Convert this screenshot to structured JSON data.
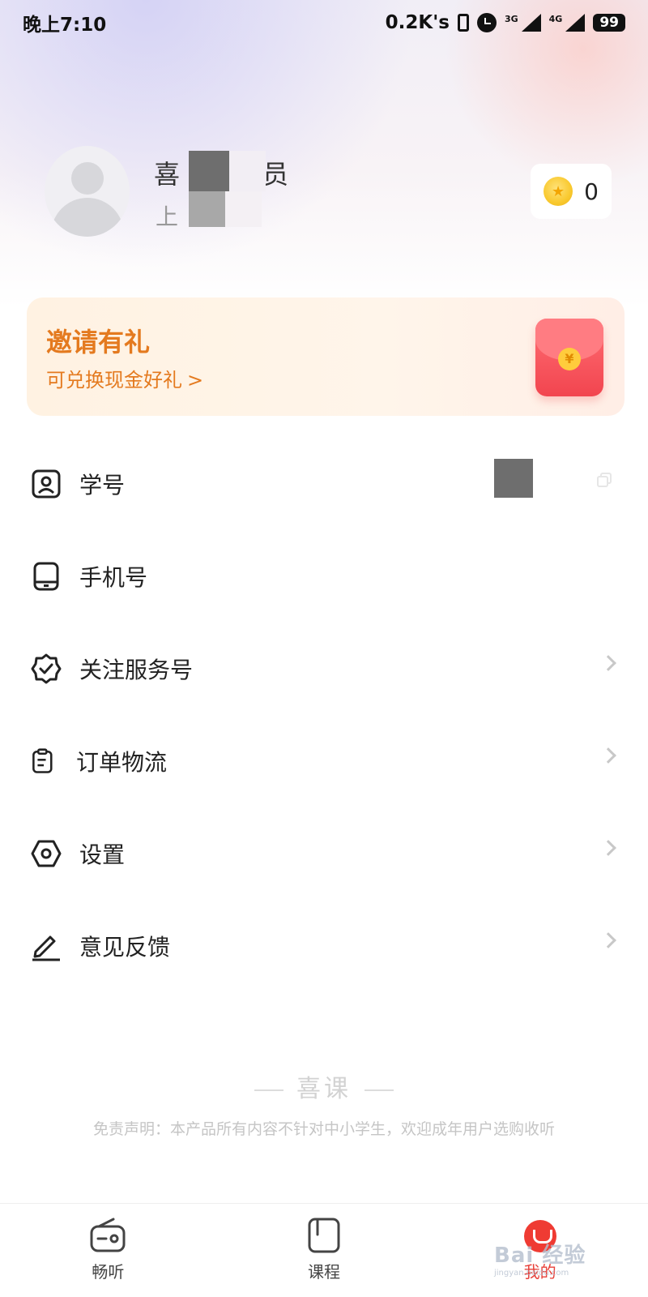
{
  "status_bar": {
    "time": "晚上7:10",
    "net_speed": "0.2K's",
    "signal1_label": "3G",
    "signal2_label": "4G",
    "battery": "99"
  },
  "profile": {
    "name_visible_start": "喜",
    "name_visible_end": "员",
    "sub_visible_start": "上",
    "coin_icon": "coin-icon",
    "coins": "0"
  },
  "invite": {
    "title": "邀请有礼",
    "subtitle": "可兑换现金好礼",
    "arrow": ">",
    "seal": "¥"
  },
  "menu": {
    "items": [
      {
        "label": "学号",
        "icon": "id-card-icon"
      },
      {
        "label": "手机号",
        "icon": "phone-icon"
      },
      {
        "label": "关注服务号",
        "icon": "verified-badge-icon"
      },
      {
        "label": "订单物流",
        "icon": "clipboard-icon"
      },
      {
        "label": "设置",
        "icon": "settings-hexagon-icon"
      },
      {
        "label": "意见反馈",
        "icon": "edit-pen-icon"
      }
    ]
  },
  "footer": {
    "brand": "喜课",
    "disclaimer": "免责声明：本产品所有内容不针对中小学生，欢迎成年用户选购收听"
  },
  "tabbar": {
    "tabs": [
      {
        "label": "畅听",
        "icon": "radio-icon"
      },
      {
        "label": "课程",
        "icon": "course-icon"
      },
      {
        "label": "我的",
        "icon": "mine-icon"
      }
    ],
    "active": "我的"
  },
  "watermark": {
    "text": "Bai 经验",
    "sub": "jingyan.baidu.com"
  },
  "colors": {
    "accent_orange": "#e47a1f",
    "accent_red": "#ef3b33"
  }
}
